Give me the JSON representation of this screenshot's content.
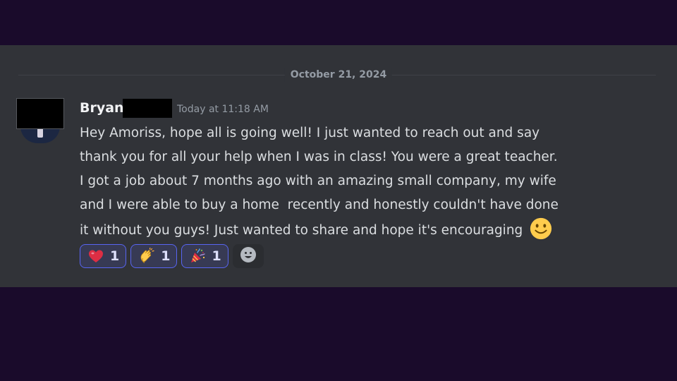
{
  "divider": {
    "date": "October 21, 2024"
  },
  "message": {
    "author": "Bryan",
    "timestamp": "Today at 11:18 AM",
    "lines": [
      "Hey Amoriss, hope all is going well! I just wanted to reach out and say",
      "thank you for all your help when I was in class! You were a great teacher.",
      "I got a job about 7 months ago with an amazing small company, my wife",
      "and I were able to buy a home  recently and honestly couldn't have done",
      "it without you guys! Just wanted to share and hope it's encouraging "
    ],
    "trailing_emoji": "slightly-smiling-face-icon"
  },
  "reactions": [
    {
      "emoji": "red-heart-icon",
      "count": "1"
    },
    {
      "emoji": "clapping-hands-icon",
      "count": "1"
    },
    {
      "emoji": "party-popper-icon",
      "count": "1"
    }
  ],
  "add_reaction": {
    "icon": "add-reaction-smiley-icon"
  },
  "colors": {
    "outer_background": "#1a0b2b",
    "panel_background": "#313338",
    "reaction_border": "#5865f2",
    "reaction_background": "#373a54"
  }
}
